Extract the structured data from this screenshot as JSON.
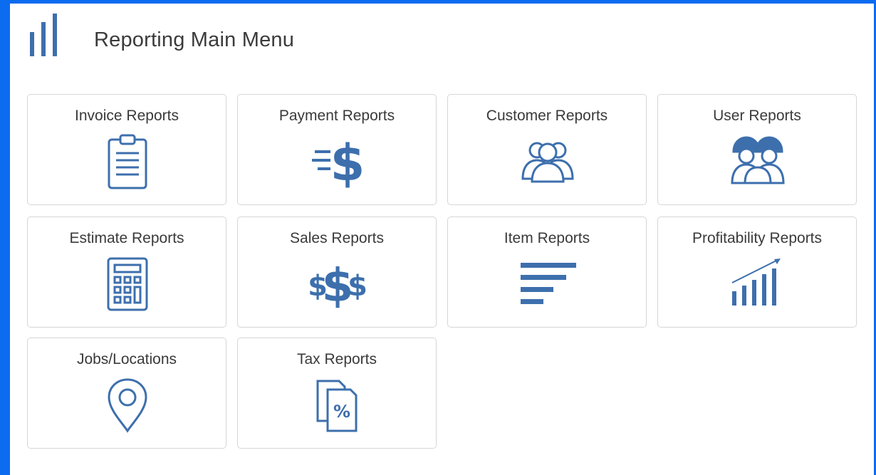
{
  "page": {
    "title": "Reporting Main Menu"
  },
  "accent_color": "#3d6fad",
  "tiles": [
    {
      "label": "Invoice Reports",
      "icon": "clipboard-icon"
    },
    {
      "label": "Payment Reports",
      "icon": "fast-dollar-icon"
    },
    {
      "label": "Customer Reports",
      "icon": "customers-group-icon"
    },
    {
      "label": "User Reports",
      "icon": "workers-hardhat-icon"
    },
    {
      "label": "Estimate Reports",
      "icon": "calculator-icon"
    },
    {
      "label": "Sales Reports",
      "icon": "multiple-dollars-icon"
    },
    {
      "label": "Item Reports",
      "icon": "list-bars-icon"
    },
    {
      "label": "Profitability Reports",
      "icon": "growth-chart-icon"
    },
    {
      "label": "Jobs/Locations",
      "icon": "location-pin-icon"
    },
    {
      "label": "Tax Reports",
      "icon": "tax-documents-icon"
    }
  ]
}
